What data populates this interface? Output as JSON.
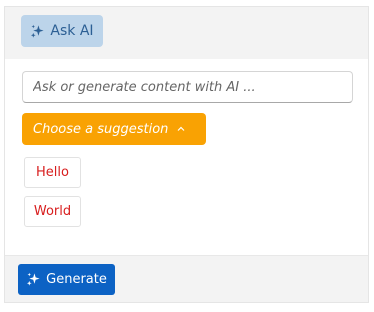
{
  "header": {
    "ask_ai_label": "Ask AI",
    "ask_ai_icon": "sparkle-icon"
  },
  "prompt": {
    "placeholder": "Ask or generate content with AI ...",
    "value": ""
  },
  "suggestions": {
    "dropdown_label": "Choose a suggestion",
    "dropdown_icon": "chevron-up-icon",
    "items": [
      {
        "label": "Hello"
      },
      {
        "label": "World"
      }
    ]
  },
  "footer": {
    "generate_label": "Generate",
    "generate_icon": "sparkle-icon"
  },
  "colors": {
    "ask_ai_bg": "#bcd4ea",
    "accent_orange": "#f9a203",
    "chip_text": "#d81e1e",
    "primary_blue": "#0c62c4"
  }
}
